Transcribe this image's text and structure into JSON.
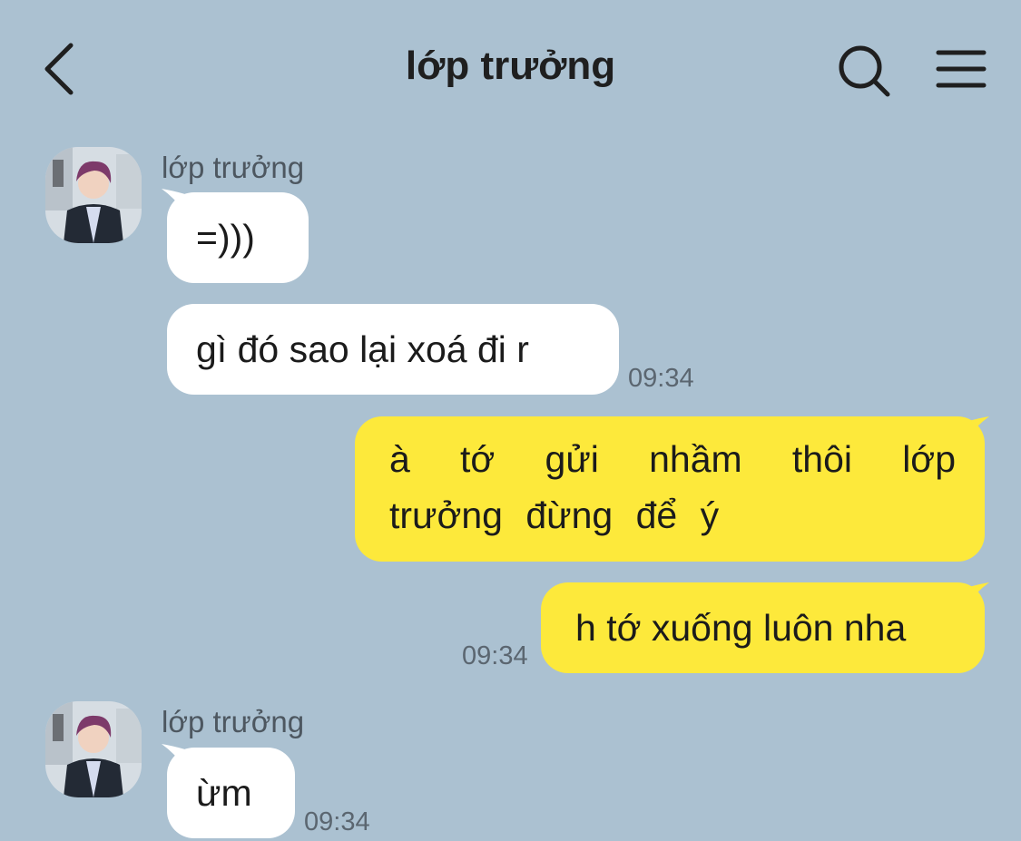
{
  "header": {
    "title": "lớp trưởng",
    "back_icon": "chevron-left-icon",
    "search_icon": "search-icon",
    "menu_icon": "hamburger-menu-icon"
  },
  "colors": {
    "background": "#abc1d1",
    "incoming_bubble": "#ffffff",
    "outgoing_bubble": "#fde93b"
  },
  "messages": [
    {
      "sender": "lớp trưởng",
      "text": "=)))",
      "direction": "incoming"
    },
    {
      "text": "gì đó sao lại xoá đi r",
      "time": "09:34",
      "direction": "incoming"
    },
    {
      "text": "à tớ gửi nhầm thôi lớp trưởng đừng để ý",
      "direction": "outgoing"
    },
    {
      "text": "h tớ xuống luôn nha",
      "time": "09:34",
      "direction": "outgoing"
    },
    {
      "sender": "lớp trưởng",
      "text": "ừm",
      "time": "09:34",
      "direction": "incoming"
    }
  ]
}
